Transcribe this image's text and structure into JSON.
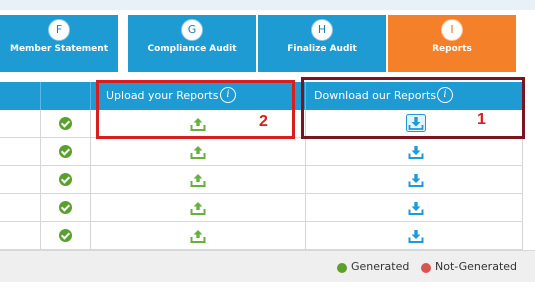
{
  "steps": [
    {
      "letter": "F",
      "label": "Member Statement"
    },
    {
      "letter": "G",
      "label": "Compliance Audit"
    },
    {
      "letter": "H",
      "label": "Finalize Audit"
    },
    {
      "letter": "I",
      "label": "Reports",
      "active": true
    }
  ],
  "table": {
    "columns": {
      "upload": "Upload your Reports",
      "download": "Download our Reports"
    },
    "rows": [
      {
        "status": "Generated"
      },
      {
        "status": "Generated"
      },
      {
        "status": "Generated"
      },
      {
        "status": "Generated"
      },
      {
        "status": "Generated"
      }
    ]
  },
  "legend": {
    "generated": "Generated",
    "not_generated": "Not-Generated"
  },
  "annotations": {
    "download_marker": "1",
    "upload_marker": "2"
  },
  "colors": {
    "accent": "#1f9bd4",
    "active_tab": "#f5802a",
    "generated": "#5aa02c",
    "not_generated": "#d9534f",
    "upload_icon": "#6aaf3d",
    "download_icon": "#1f9bd4",
    "annotation_dark": "#7a1420",
    "annotation_red": "#d81e1e"
  },
  "icons": {
    "status": "check-circle-icon",
    "upload": "upload-tray-icon",
    "download": "download-tray-icon",
    "info": "info-icon"
  }
}
